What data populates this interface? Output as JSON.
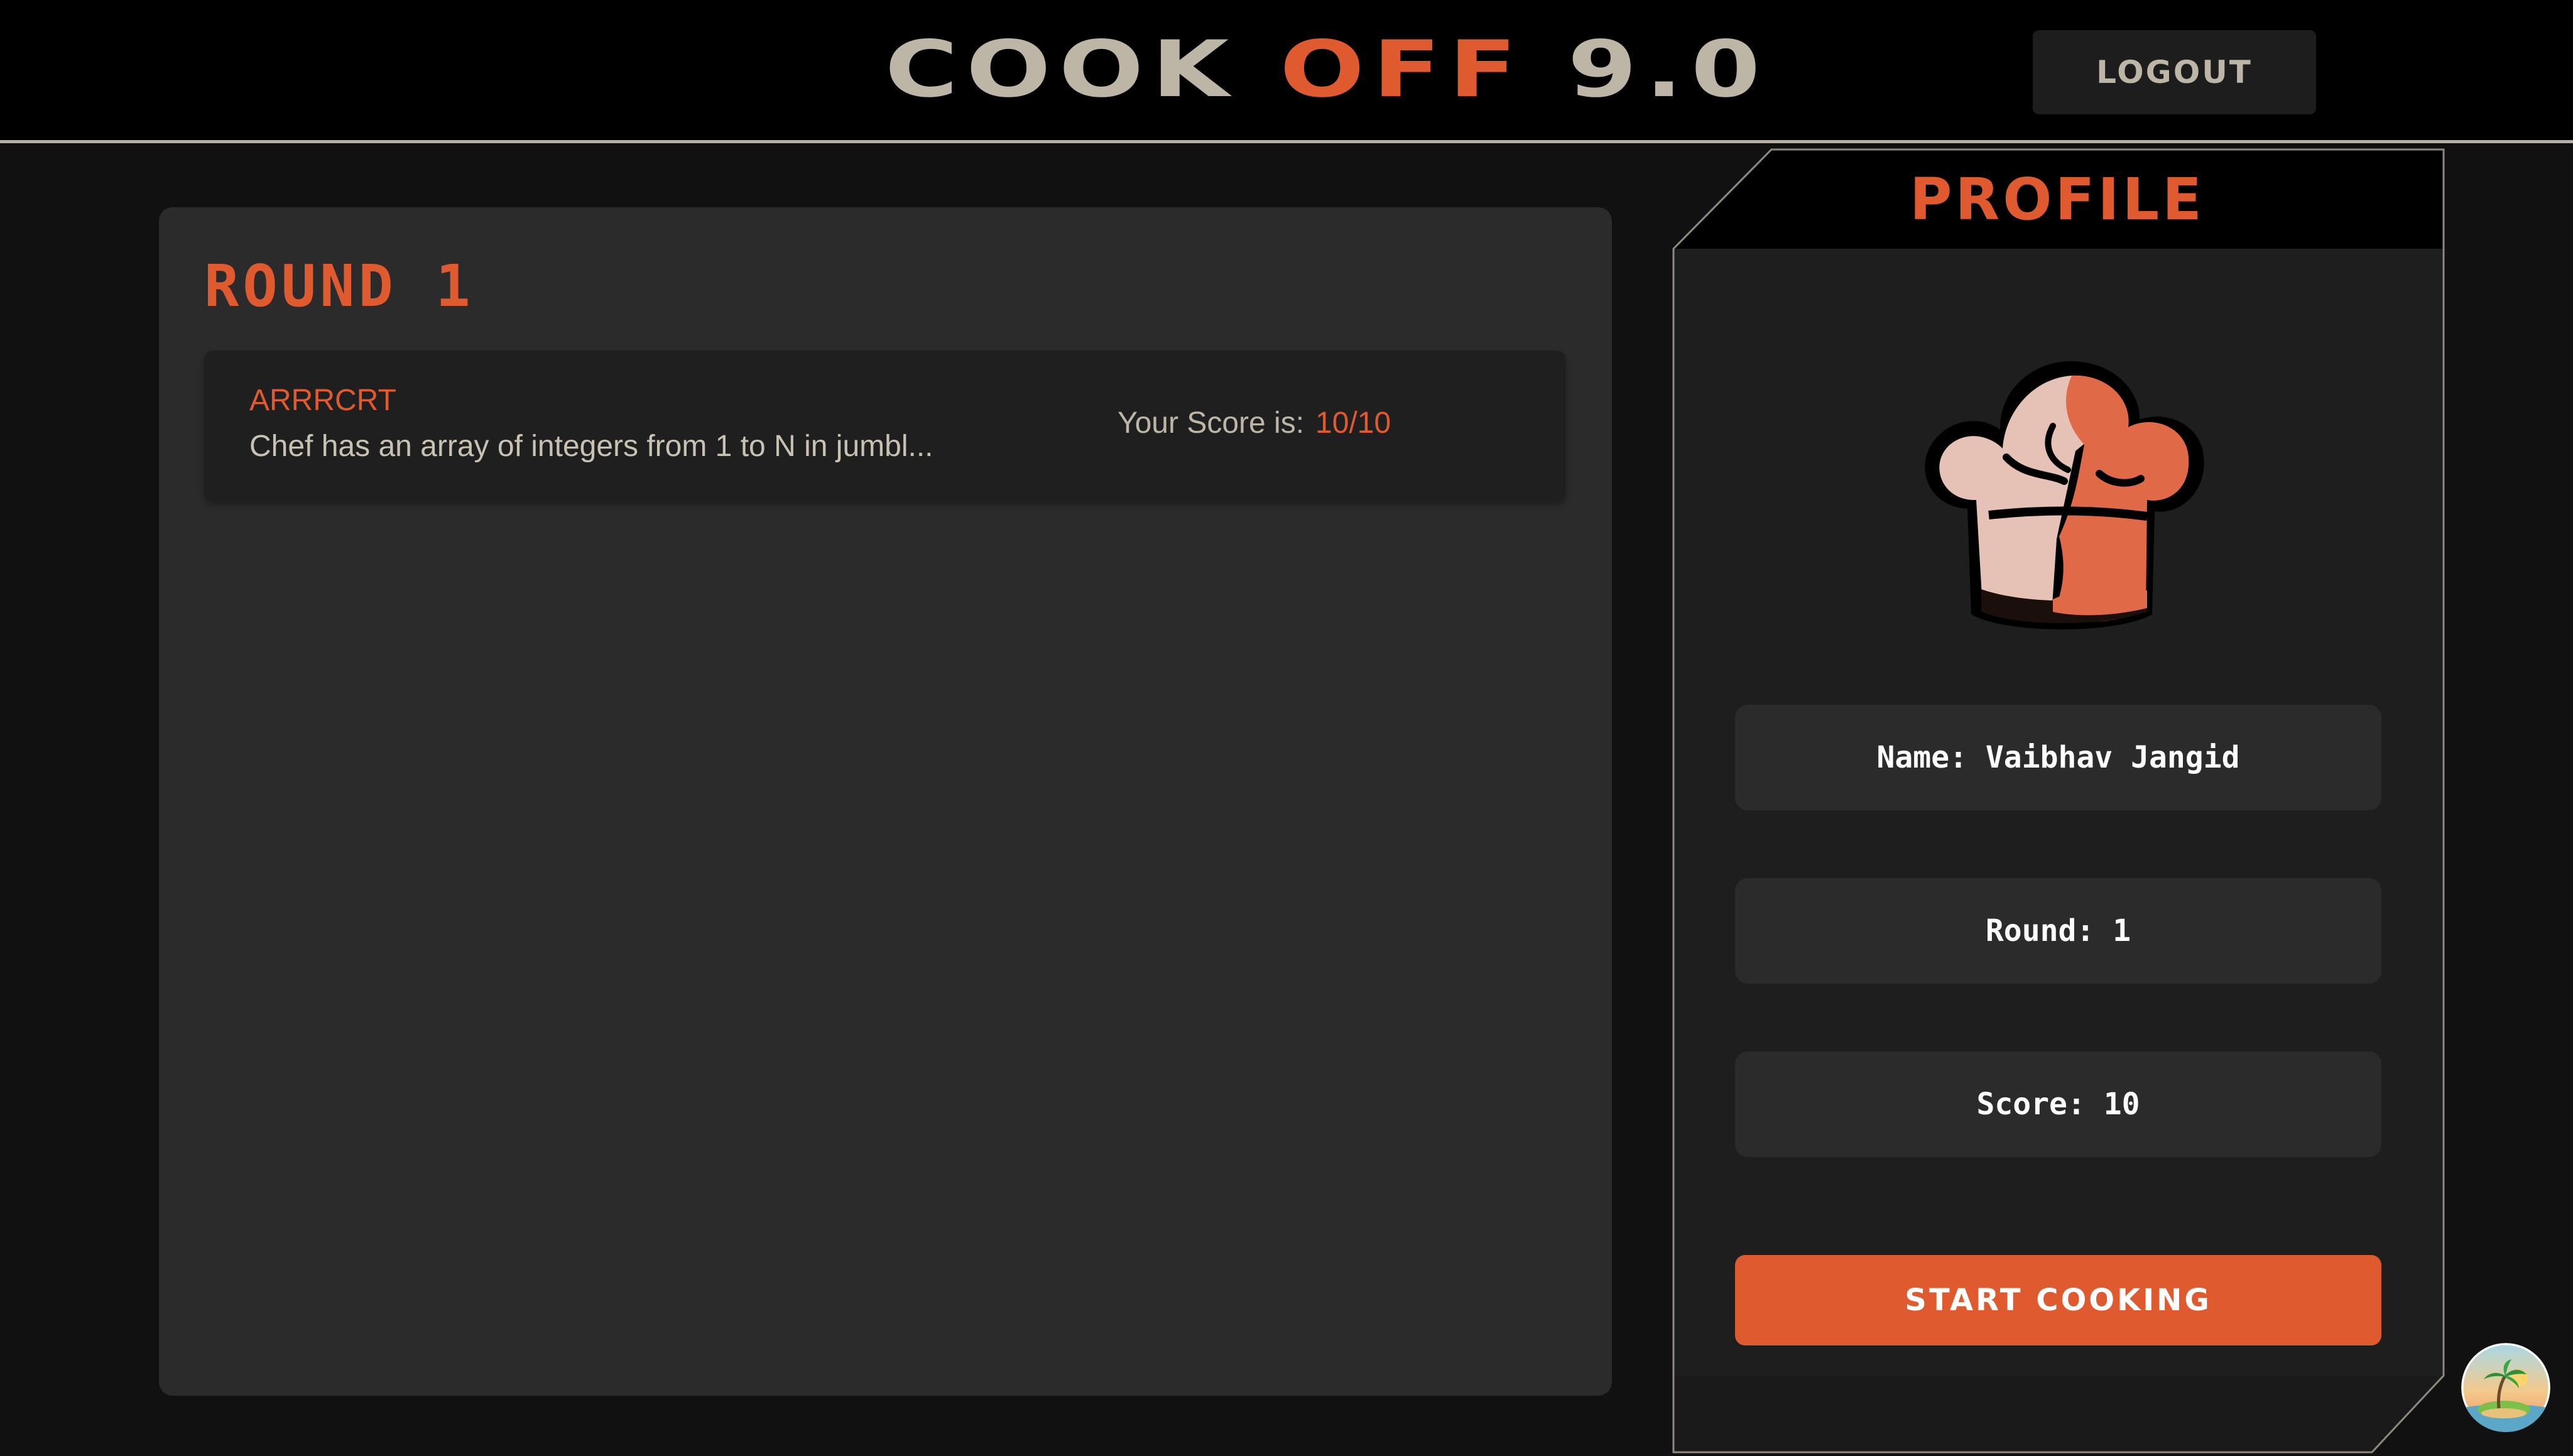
{
  "header": {
    "brand_word1": "COOK",
    "brand_word2": "OFF",
    "brand_word3": "9.0",
    "logout_label": "LOGOUT"
  },
  "round": {
    "title": "ROUND 1",
    "questions": [
      {
        "code": "ARRRCRT",
        "description": "Chef has an array of integers from 1 to N in jumbl...",
        "score_label": "Your Score is:",
        "score_value": "10/10"
      }
    ]
  },
  "profile": {
    "title": "PROFILE",
    "avatar_icon": "chef-hat-icon",
    "name_label": "Name:",
    "name_value": "Vaibhav Jangid",
    "round_label": "Round:",
    "round_value": "1",
    "score_label": "Score:",
    "score_value": "10",
    "start_label": "START COOKING"
  },
  "floating": {
    "icon": "island-sunset-icon"
  },
  "colors": {
    "accent": "#e05a30",
    "text_muted": "#bdb5a6",
    "background": "#111111",
    "panel": "#2b2b2b",
    "card": "#1f1f1f"
  }
}
